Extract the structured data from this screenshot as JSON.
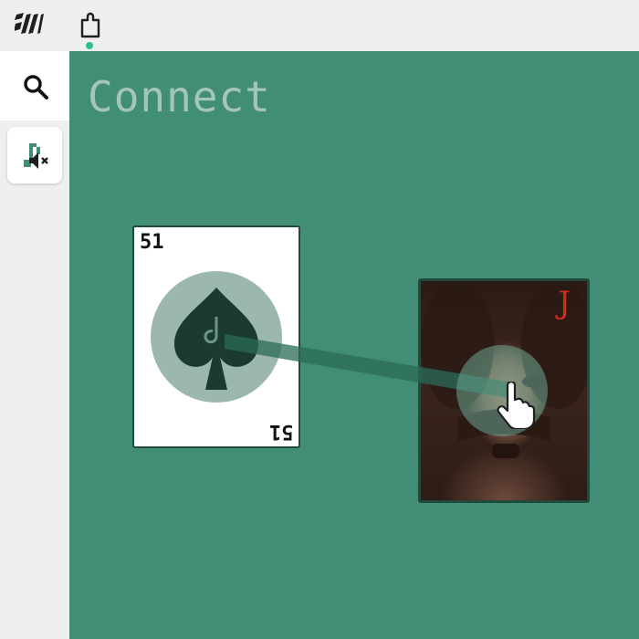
{
  "toolbar": {
    "logo_icon": "stripes-logo-icon",
    "extension_icon": "puzzle-piece-icon",
    "has_notification": true
  },
  "sidebar": {
    "search_icon": "search-icon",
    "sound_icon": "sound-muted-icon"
  },
  "stage": {
    "title": "Connect",
    "background_color": "#418d75"
  },
  "cards": {
    "left": {
      "corner_top": "51",
      "corner_bottom": "51",
      "suit": "spade"
    },
    "right": {
      "rank": "J",
      "face": "photo"
    }
  },
  "connection": {
    "from": "left",
    "to": "right",
    "dragging": true
  }
}
